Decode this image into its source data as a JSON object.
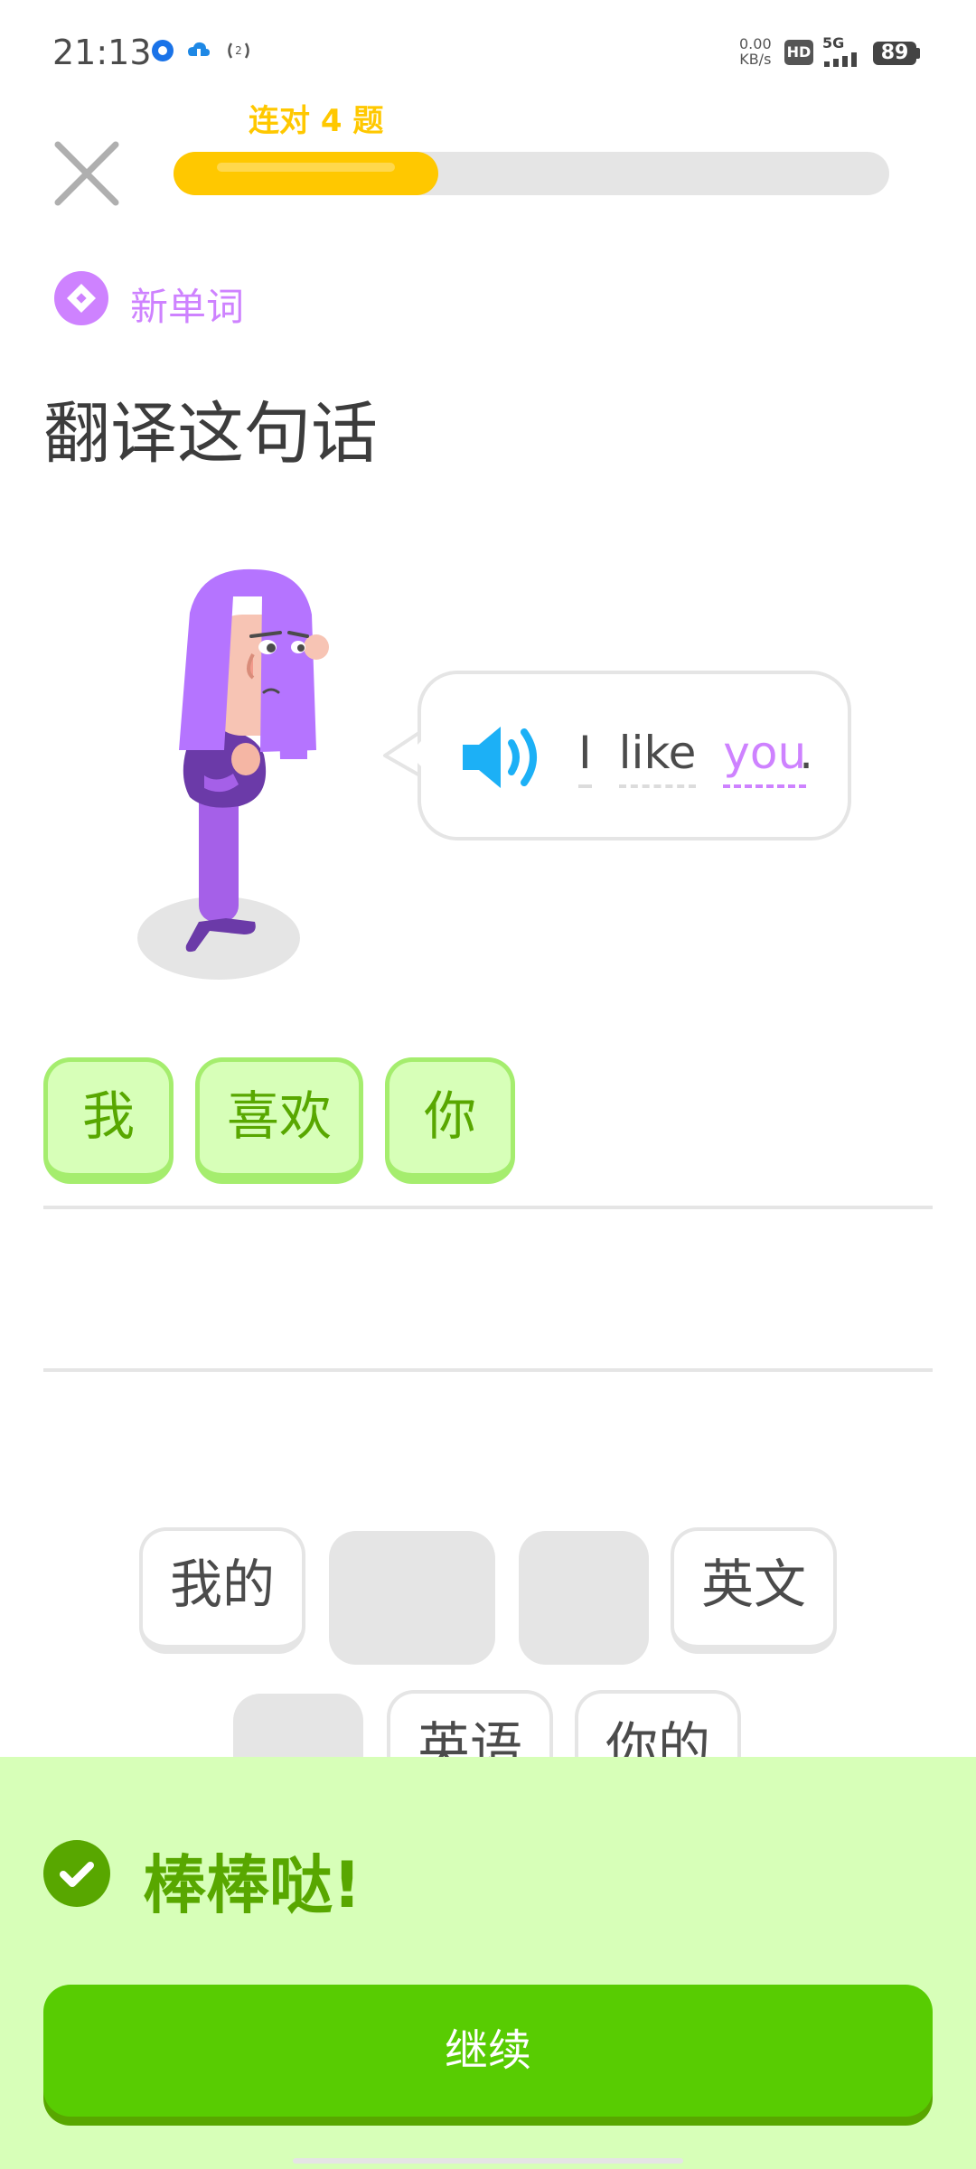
{
  "status_bar": {
    "time": "21:13",
    "net_speed_value": "0.00",
    "net_speed_unit": "KB/s",
    "hd": "HD",
    "network": "5G",
    "battery": "89"
  },
  "header": {
    "streak_label": "连对 4 题",
    "progress": 0.37
  },
  "badge": {
    "label": "新单词",
    "icon": "new-word-icon"
  },
  "prompt_title": "翻译这句话",
  "sentence": {
    "words": [
      "I",
      "like",
      "you"
    ],
    "punctuation": "."
  },
  "answer_tiles": [
    "我",
    "喜欢",
    "你"
  ],
  "word_bank": {
    "row1": [
      "我的",
      "",
      "",
      "英文"
    ],
    "row2": [
      "",
      "英语",
      "你的"
    ]
  },
  "feedback": {
    "title": "棒棒哒!",
    "continue_label": "继续"
  },
  "colors": {
    "streak": "#ffc800",
    "new_word": "#ce82ff",
    "correct_text": "#58a700",
    "correct_bg": "#d7ffb8",
    "button": "#58cc02",
    "speaker": "#1cb0f6"
  }
}
